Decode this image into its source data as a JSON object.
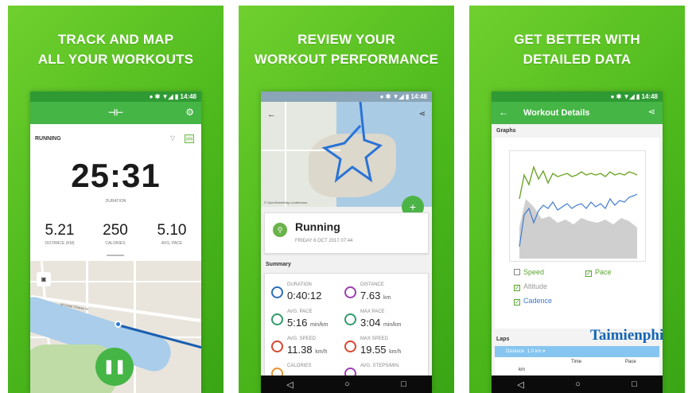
{
  "panels": [
    {
      "headline_1": "TRACK AND MAP",
      "headline_2": "ALL YOUR WORKOUTS"
    },
    {
      "headline_1": "REVIEW YOUR",
      "headline_2": "WORKOUT PERFORMANCE"
    },
    {
      "headline_1": "GET BETTER WITH",
      "headline_2": "DETAILED DATA"
    }
  ],
  "status_time": "14:48",
  "phone1": {
    "activity": "RUNNING",
    "gps": "GPS",
    "timer": "25:31",
    "timer_caption": "DURATION",
    "stats": [
      {
        "value": "5.21",
        "caption": "DISTANCE (KM)"
      },
      {
        "value": "250",
        "caption": "CALORIES"
      },
      {
        "value": "5.10",
        "caption": "AVG. PACE"
      }
    ],
    "map_road_label": "W Cesar Chavez St",
    "pause_icon": "pause-icon"
  },
  "phone2": {
    "attribution": "© OpenStreetMap contributors",
    "title": "Running",
    "date": "FRIDAY 6 OCT 2017 07:44",
    "summary_label": "Summary",
    "metrics": [
      {
        "label": "DURATION",
        "value": "0:40:12",
        "unit": ""
      },
      {
        "label": "DISTANCE",
        "value": "7.63",
        "unit": "km"
      },
      {
        "label": "AVG. PACE",
        "value": "5:16",
        "unit": "min/km"
      },
      {
        "label": "MAX PACE",
        "value": "3:04",
        "unit": "min/km"
      },
      {
        "label": "AVG. SPEED",
        "value": "11.38",
        "unit": "km/h"
      },
      {
        "label": "MAX SPEED",
        "value": "19.55",
        "unit": "km/h"
      },
      {
        "label": "CALORIES",
        "value": "",
        "unit": ""
      },
      {
        "label": "AVG. STEPS/MIN.",
        "value": "",
        "unit": ""
      }
    ]
  },
  "phone3": {
    "title": "Workout Details",
    "graphs_label": "Graphs",
    "checkboxes": [
      {
        "label": "Speed",
        "checked": false
      },
      {
        "label": "Pace",
        "checked": true
      },
      {
        "label": "Altitude",
        "checked": true
      },
      {
        "label": "Cadence",
        "checked": true
      }
    ],
    "laps_label": "Laps",
    "distance_label": "Distance",
    "distance_value": "1.0 km",
    "col_km": "km",
    "col_time": "Time",
    "col_pace": "Pace"
  },
  "watermark": "Taimienphi"
}
